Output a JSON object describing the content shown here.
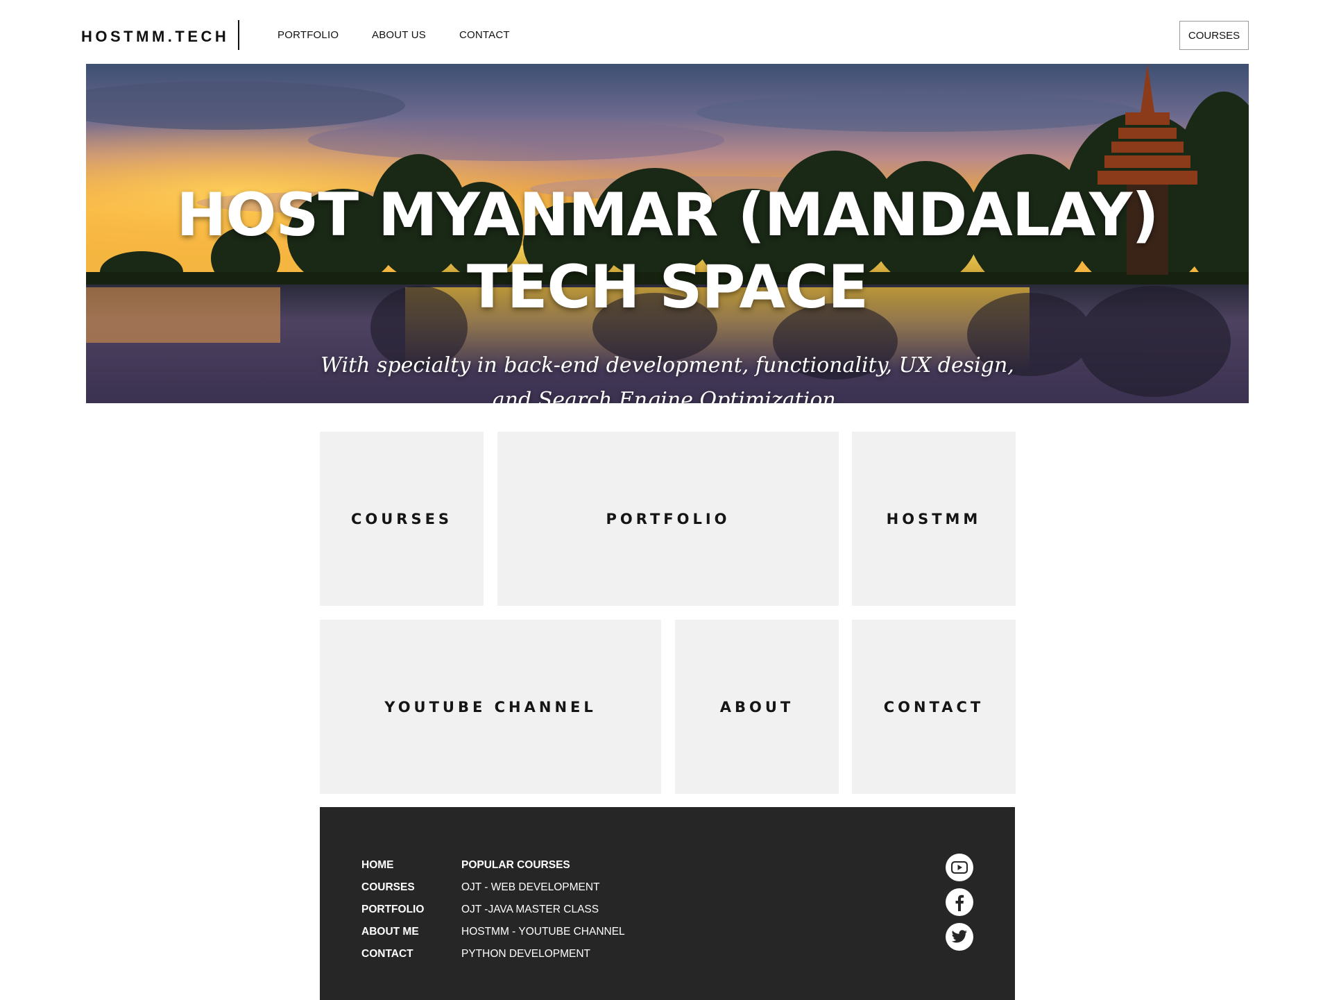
{
  "nav": {
    "logo": "HOSTMM.TECH",
    "links": [
      "PORTFOLIO",
      "ABOUT US",
      "CONTACT"
    ],
    "courses_button": "COURSES"
  },
  "hero": {
    "title_line1": "HOST MYANMAR (MANDALAY)",
    "title_line2": "TECH SPACE",
    "subtitle_line1": "With specialty in back-end development, functionality, UX design,",
    "subtitle_line2": "and Search Engine Optimization."
  },
  "tiles": {
    "courses": "COURSES",
    "portfolio": "PORTFOLIO",
    "hostmm": "HOSTMM",
    "youtube": "YOUTUBE CHANNEL",
    "about": "ABOUT",
    "contact": "CONTACT"
  },
  "footer": {
    "nav_links": [
      "HOME",
      "COURSES",
      "PORTFOLIO",
      "ABOUT ME",
      "CONTACT"
    ],
    "popular_heading": "POPULAR COURSES",
    "popular_courses": [
      "OJT - WEB DEVELOPMENT",
      "OJT -JAVA MASTER CLASS",
      "HOSTMM - YOUTUBE CHANNEL",
      "PYTHON DEVELOPMENT"
    ],
    "social_icons": [
      "youtube-icon",
      "facebook-icon",
      "twitter-icon"
    ]
  },
  "colors": {
    "tile_bg": "#f1f1f1",
    "footer_bg": "#262626",
    "text": "#111111"
  }
}
